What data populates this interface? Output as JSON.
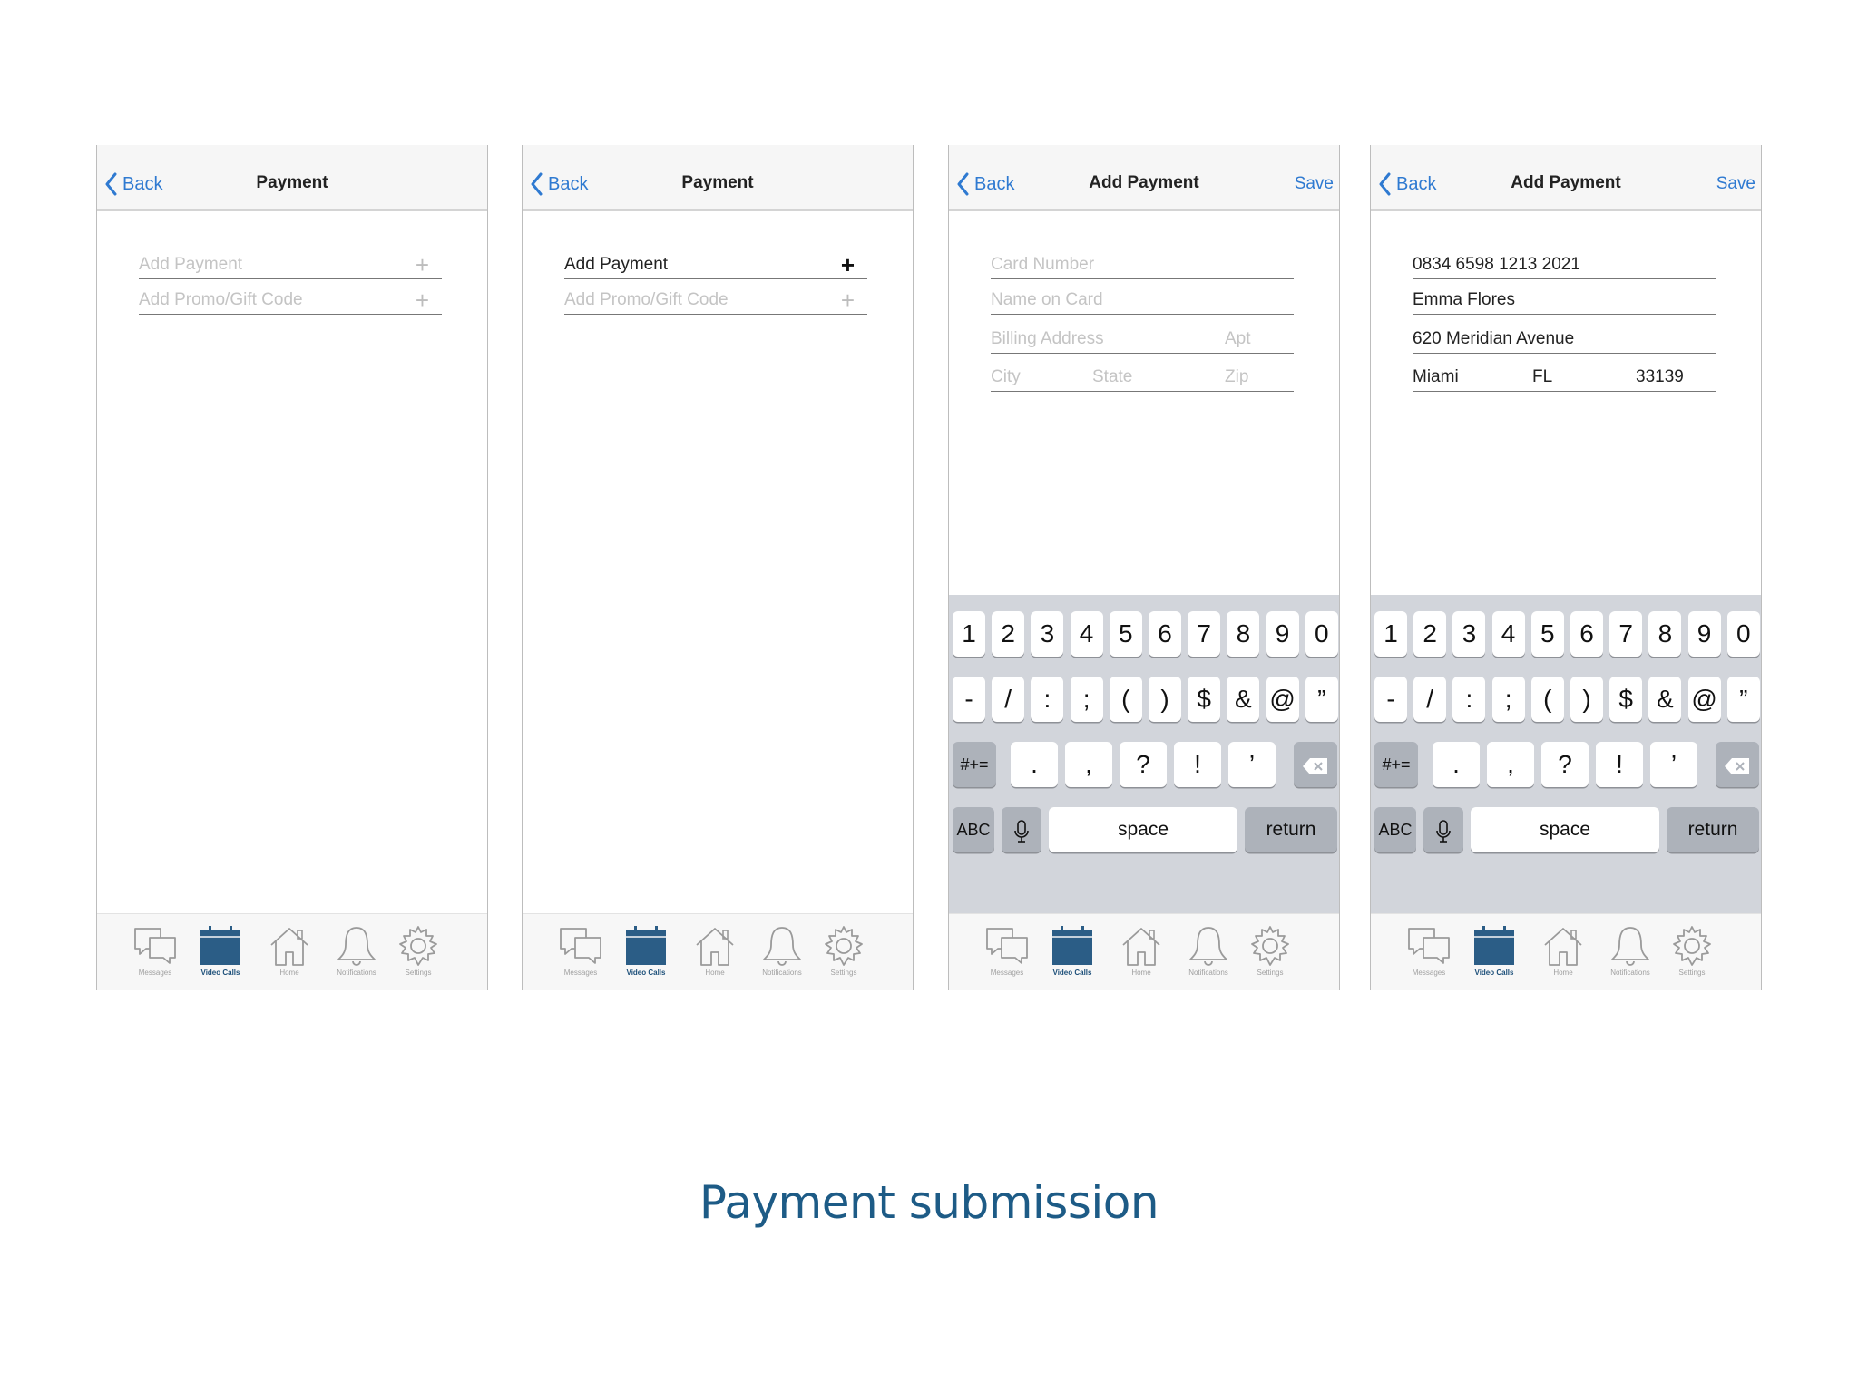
{
  "caption": "Payment submission",
  "nav": {
    "back": "Back",
    "save": "Save"
  },
  "tabs": [
    {
      "label": "Messages",
      "icon": "chat-bubbles-icon"
    },
    {
      "label": "Video Calls",
      "icon": "calendar-icon"
    },
    {
      "label": "Home",
      "icon": "home-icon"
    },
    {
      "label": "Notifications",
      "icon": "bell-icon"
    },
    {
      "label": "Settings",
      "icon": "gear-icon"
    }
  ],
  "keyboard": {
    "row1": [
      "1",
      "2",
      "3",
      "4",
      "5",
      "6",
      "7",
      "8",
      "9",
      "0"
    ],
    "row2": [
      "-",
      "/",
      ":",
      ";",
      "(",
      ")",
      "$",
      "&",
      "@",
      "”"
    ],
    "row3_left": "#+=",
    "row3": [
      ".",
      ",",
      "?",
      "!",
      "’"
    ],
    "abc": "ABC",
    "space": "space",
    "return": "return"
  },
  "screens": [
    {
      "title": "Payment",
      "rows": [
        {
          "text": "Add Payment",
          "plus": "+"
        },
        {
          "text": "Add Promo/Gift Code",
          "plus": "+"
        }
      ]
    },
    {
      "title": "Payment",
      "rows": [
        {
          "text": "Add Payment",
          "plus": "+"
        },
        {
          "text": "Add Promo/Gift Code",
          "plus": "+"
        }
      ]
    },
    {
      "title": "Add Payment",
      "fields": {
        "card": "Card Number",
        "name": "Name on Card",
        "address": "Billing Address",
        "apt": "Apt",
        "city": "City",
        "state": "State",
        "zip": "Zip"
      }
    },
    {
      "title": "Add Payment",
      "fields": {
        "card": "0834 6598 1213 2021",
        "name": "Emma Flores",
        "address": "620 Meridian Avenue",
        "city": "Miami",
        "state": "FL",
        "zip": "33139"
      }
    }
  ],
  "colors": {
    "accent": "#2f7ad1",
    "brand": "#1c4f79",
    "caption": "#1d5b86"
  }
}
